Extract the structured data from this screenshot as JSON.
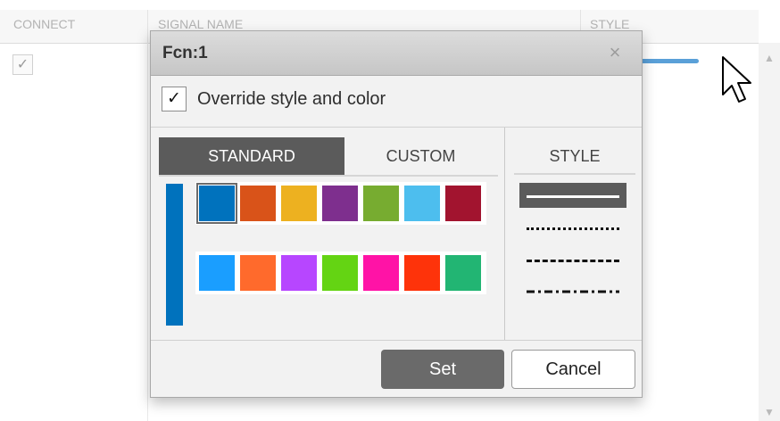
{
  "table": {
    "columns": [
      "CONNECT",
      "SIGNAL NAME",
      "STYLE"
    ],
    "row_checkbox": "✓"
  },
  "dialog": {
    "title": "Fcn:1",
    "close_glyph": "×",
    "override": {
      "checked": true,
      "glyph": "✓",
      "label": "Override style and color"
    },
    "tabs": {
      "standard": "STANDARD",
      "custom": "CUSTOM",
      "active": "STANDARD"
    },
    "current_color": "#0072bd",
    "swatches_row1": [
      "#0072bd",
      "#d95319",
      "#edb120",
      "#7e2f8e",
      "#77ac30",
      "#4dbeee",
      "#a2142f"
    ],
    "swatches_row2": [
      "#1a9eff",
      "#ff6a2c",
      "#b746ff",
      "#64d413",
      "#ff13a6",
      "#fe330a",
      "#22b573"
    ],
    "selected_swatch": "#0072bd",
    "style_header": "STYLE",
    "styles": [
      "solid",
      "dotted",
      "dashed",
      "dash-dot"
    ],
    "selected_style": "solid",
    "buttons": {
      "set": "Set",
      "cancel": "Cancel"
    }
  },
  "colors": {
    "preview_line": "#5aa0d8",
    "selected_bg": "#5b5b5b"
  }
}
